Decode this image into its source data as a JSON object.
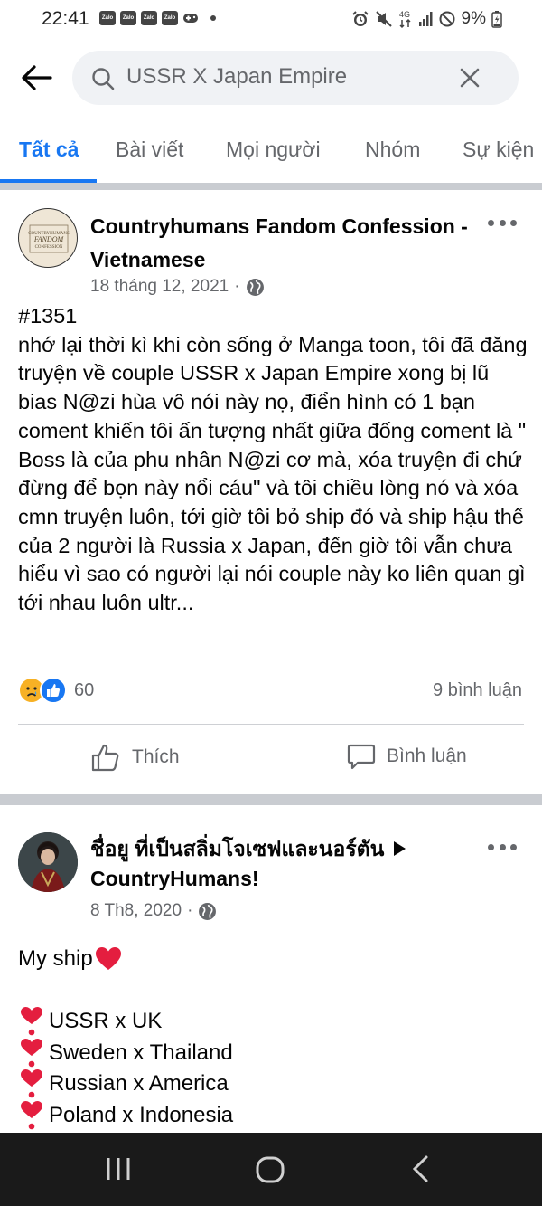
{
  "status_bar": {
    "time": "22:41",
    "notification_icons": [
      "Zalo",
      "Zalo",
      "Zalo",
      "Zalo"
    ],
    "network_label": "4G",
    "battery": "9%"
  },
  "search": {
    "query": "USSR X Japan Empire"
  },
  "tabs": [
    {
      "label": "Tất cả",
      "active": true
    },
    {
      "label": "Bài viết",
      "active": false
    },
    {
      "label": "Mọi người",
      "active": false
    },
    {
      "label": "Nhóm",
      "active": false
    },
    {
      "label": "Sự kiện",
      "active": false
    }
  ],
  "post1": {
    "author": "Countryhumans Fandom Confession - Vietnamese",
    "avatar_text": "COUNTRYHUMANS FANDOM CONFESSION",
    "date": "18 tháng 12, 2021",
    "audience_icon": "globe-icon",
    "text": "#1351\nnhớ lại thời kì khi còn sống ở Manga toon, tôi đã đăng truyện về couple USSR x Japan Empire xong bị lũ bias N@zi hùa vô nói này nọ, điển hình có 1 bạn coment khiến tôi ấn tượng nhất giữa đống coment là \" Boss là của phu nhân N@zi cơ mà, xóa truyện đi chứ đừng để bọn này nổi cáu\" và tôi chiều lòng nó và xóa cmn truyện luôn, tới giờ tôi bỏ ship đó và ship hậu thế của 2 người là Russia x Japan, đến giờ tôi vẫn chưa hiểu vì sao có người lại nói couple này ko liên quan gì tới nhau luôn ultr...",
    "reaction_count": "60",
    "comment_count": "9 bình luận",
    "like_label": "Thích",
    "comment_label": "Bình luận"
  },
  "post2": {
    "author": "ชื่อยู ที่เป็นสลิ่มโจเซฟและนอร์ตัน",
    "group": "CountryHumans!",
    "date": "8 Th8, 2020",
    "audience_icon": "globe-icon",
    "text_intro": "My ship",
    "ships": [
      "USSR x UK",
      "Sweden x Thailand",
      "Russian x America",
      "Poland x Indonesia"
    ]
  },
  "colors": {
    "accent": "#1877f2",
    "secondary_text": "#65676b",
    "heart": "#e41e3f"
  }
}
